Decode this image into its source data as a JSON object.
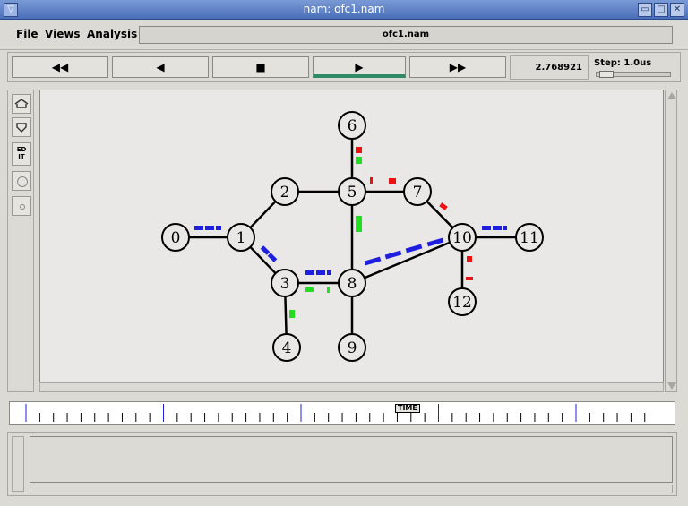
{
  "window": {
    "title": "nam: ofc1.nam",
    "menu_glyph": "▽",
    "min": "▭",
    "max": "□",
    "close": "✕"
  },
  "menu": {
    "file": "File",
    "views": "Views",
    "analysis": "Analysis",
    "filename": "ofc1.nam"
  },
  "transport": {
    "rewind": "◀◀",
    "back": "◀",
    "stop": "■",
    "play": "▶",
    "forward": "▶▶",
    "active": "play",
    "time": "2.768921",
    "step_label": "Step: 1.0us"
  },
  "tools": {
    "zoom_in_icon": "zoom-in-icon",
    "zoom_out_icon": "zoom-out-icon",
    "edit_label": "ED IT"
  },
  "timeline": {
    "marker_label": "TIME"
  },
  "colors": {
    "blue": "#1f1fe0",
    "green": "#22dd22",
    "red": "#ee1111",
    "play_accent": "#2f8a66"
  },
  "network": {
    "nodes": [
      {
        "id": "0",
        "label": "0"
      },
      {
        "id": "1",
        "label": "1"
      },
      {
        "id": "2",
        "label": "2"
      },
      {
        "id": "3",
        "label": "3"
      },
      {
        "id": "4",
        "label": "4"
      },
      {
        "id": "5",
        "label": "5"
      },
      {
        "id": "6",
        "label": "6"
      },
      {
        "id": "7",
        "label": "7"
      },
      {
        "id": "8",
        "label": "8"
      },
      {
        "id": "9",
        "label": "9"
      },
      {
        "id": "10",
        "label": "10"
      },
      {
        "id": "11",
        "label": "11"
      },
      {
        "id": "12",
        "label": "12"
      }
    ],
    "links": [
      [
        "0",
        "1"
      ],
      [
        "1",
        "2"
      ],
      [
        "2",
        "5"
      ],
      [
        "1",
        "3"
      ],
      [
        "3",
        "8"
      ],
      [
        "3",
        "4"
      ],
      [
        "5",
        "6"
      ],
      [
        "5",
        "7"
      ],
      [
        "5",
        "8"
      ],
      [
        "7",
        "10"
      ],
      [
        "8",
        "10"
      ],
      [
        "8",
        "9"
      ],
      [
        "10",
        "11"
      ],
      [
        "10",
        "12"
      ]
    ]
  }
}
